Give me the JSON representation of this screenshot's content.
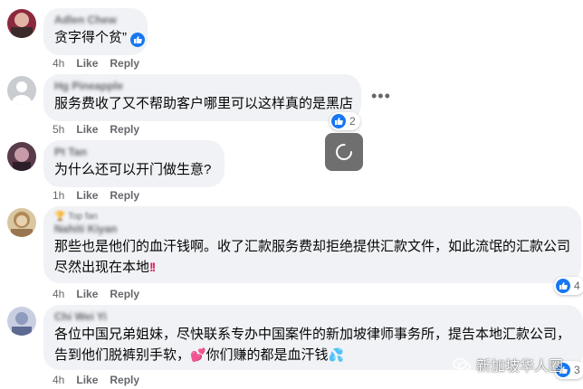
{
  "comments": [
    {
      "author": "Adlen Chew",
      "text": "贪字得个贫”",
      "time": "4h",
      "like_label": "Like",
      "reply_label": "Reply",
      "reaction_count": ""
    },
    {
      "author": "Hg Pineapple",
      "text": "服务费收了又不帮助客户哪里可以这样真的是黑店",
      "time": "5h",
      "like_label": "Like",
      "reply_label": "Reply",
      "reaction_count": "2"
    },
    {
      "author": "Pt Tan",
      "text": "为什么还可以开门做生意?",
      "time": "1h",
      "like_label": "Like",
      "reply_label": "Reply",
      "reaction_count": ""
    },
    {
      "badge": "Top fan",
      "author": "Nahiti Kiyan",
      "text_line1": "那些也是他们的血汗钱啊。收了汇款服务费却拒绝提供汇款文件，如此流氓的汇款公司",
      "text_line2": "尽然出现在本地",
      "time": "4h",
      "like_label": "Like",
      "reply_label": "Reply",
      "reaction_count": "4"
    },
    {
      "author": "Chi Wei Yi",
      "text_line1": "各位中国兄弟姐妹，尽快联系专办中国案件的新加坡律师事务所，提告本地汇款公司，",
      "text_line2a": "告到他们脱裤别手软，",
      "text_line2b": "你们赚的都是血汗钱",
      "time": "4h",
      "like_label": "Like",
      "reply_label": "Reply",
      "reaction_count": "3"
    }
  ],
  "more_options": "•••",
  "watermark": "新加坡华人圈",
  "colors": {
    "bubble": "#f0f2f5",
    "like_blue": "#1877f2",
    "meta_gray": "#65676b"
  }
}
